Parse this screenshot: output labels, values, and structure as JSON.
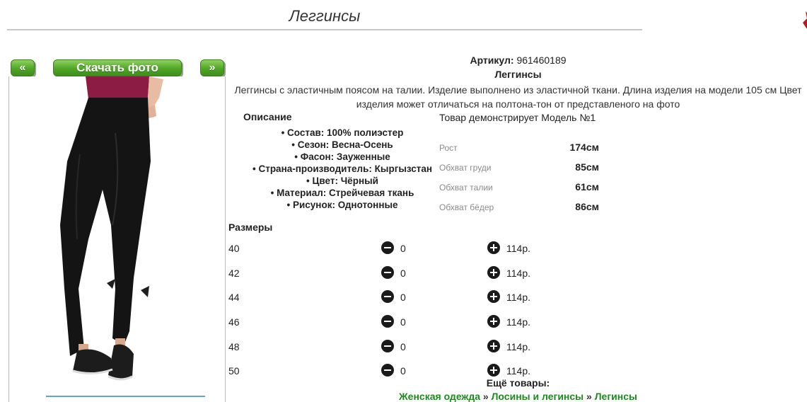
{
  "page": {
    "title": "Леггинсы"
  },
  "gallery": {
    "prev_label": "«",
    "download_label": "Скачать фото",
    "next_label": "»"
  },
  "product": {
    "article_label": "Артикул:",
    "article_value": "961460189",
    "name": "Леггинсы",
    "description_line1": "Леггинсы с эластичным поясом на талии. Изделие выполнено из эластичной ткани. Длина изделия на модели 105 см Цвет",
    "description_line2": "изделия может отличаться на полтона-тон от представленого на фото"
  },
  "description": {
    "title": "Описание",
    "features": [
      "Состав: 100% полиэстер",
      "Сезон: Весна-Осень",
      "Фасон: Зауженные",
      "Страна-производитель: Кыргызстан",
      "Цвет: Чёрный",
      "Материал: Стрейчевая ткань",
      "Рисунок: Однотонные"
    ]
  },
  "model": {
    "title": "Товар демонстрирует Модель №1",
    "measurements": [
      {
        "label": "Рост",
        "value": "174см"
      },
      {
        "label": "Обхват груди",
        "value": "85см"
      },
      {
        "label": "Обхват талии",
        "value": "61см"
      },
      {
        "label": "Обхват бёдер",
        "value": "86см"
      }
    ]
  },
  "sizes": {
    "title": "Размеры",
    "rows": [
      {
        "size": "40",
        "qty": "0",
        "price": "114р."
      },
      {
        "size": "42",
        "qty": "0",
        "price": "114р."
      },
      {
        "size": "44",
        "qty": "0",
        "price": "114р."
      },
      {
        "size": "46",
        "qty": "0",
        "price": "114р."
      },
      {
        "size": "48",
        "qty": "0",
        "price": "114р."
      },
      {
        "size": "50",
        "qty": "0",
        "price": "114р."
      }
    ]
  },
  "more": {
    "title": "Ещё товары:",
    "links": [
      "Женская одежда",
      "Лосины и легинсы",
      "Легинсы"
    ],
    "separator": " » "
  },
  "colors": {
    "button_green": "#4fa526",
    "link_green": "#1c8a1c",
    "deco_red": "#c0141e"
  },
  "icons": {
    "minus": "minus-circle-icon",
    "plus": "plus-circle-icon"
  }
}
